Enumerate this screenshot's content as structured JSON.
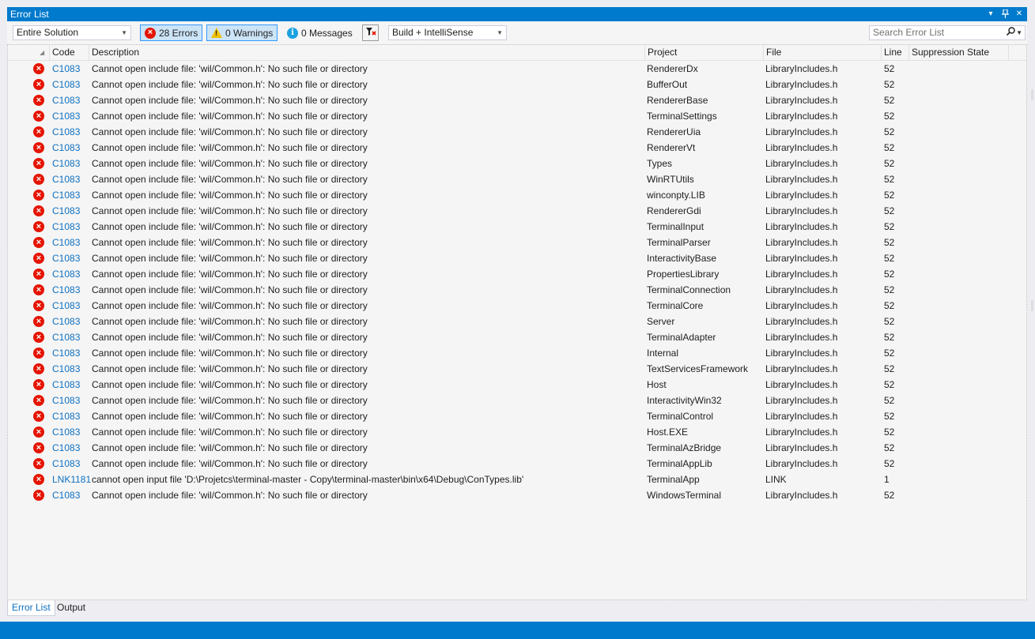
{
  "panel": {
    "title": "Error List",
    "menu_glyph": "▾",
    "pin_glyph": "📌",
    "close_glyph": "✕"
  },
  "toolbar": {
    "scope": "Entire Solution",
    "errors_label": "28 Errors",
    "warnings_label": "0 Warnings",
    "messages_label": "0 Messages",
    "source": "Build + IntelliSense",
    "search_placeholder": "Search Error List"
  },
  "columns": {
    "code": "Code",
    "description": "Description",
    "project": "Project",
    "file": "File",
    "line": "Line",
    "suppression": "Suppression State"
  },
  "rows": [
    {
      "code": "C1083",
      "description": "Cannot open include file: 'wil/Common.h': No such file or directory",
      "project": "RendererDx",
      "file": "LibraryIncludes.h",
      "line": "52"
    },
    {
      "code": "C1083",
      "description": "Cannot open include file: 'wil/Common.h': No such file or directory",
      "project": "BufferOut",
      "file": "LibraryIncludes.h",
      "line": "52"
    },
    {
      "code": "C1083",
      "description": "Cannot open include file: 'wil/Common.h': No such file or directory",
      "project": "RendererBase",
      "file": "LibraryIncludes.h",
      "line": "52"
    },
    {
      "code": "C1083",
      "description": "Cannot open include file: 'wil/Common.h': No such file or directory",
      "project": "TerminalSettings",
      "file": "LibraryIncludes.h",
      "line": "52"
    },
    {
      "code": "C1083",
      "description": "Cannot open include file: 'wil/Common.h': No such file or directory",
      "project": "RendererUia",
      "file": "LibraryIncludes.h",
      "line": "52"
    },
    {
      "code": "C1083",
      "description": "Cannot open include file: 'wil/Common.h': No such file or directory",
      "project": "RendererVt",
      "file": "LibraryIncludes.h",
      "line": "52"
    },
    {
      "code": "C1083",
      "description": "Cannot open include file: 'wil/Common.h': No such file or directory",
      "project": "Types",
      "file": "LibraryIncludes.h",
      "line": "52"
    },
    {
      "code": "C1083",
      "description": "Cannot open include file: 'wil/Common.h': No such file or directory",
      "project": "WinRTUtils",
      "file": "LibraryIncludes.h",
      "line": "52"
    },
    {
      "code": "C1083",
      "description": "Cannot open include file: 'wil/Common.h': No such file or directory",
      "project": "winconpty.LIB",
      "file": "LibraryIncludes.h",
      "line": "52"
    },
    {
      "code": "C1083",
      "description": "Cannot open include file: 'wil/Common.h': No such file or directory",
      "project": "RendererGdi",
      "file": "LibraryIncludes.h",
      "line": "52"
    },
    {
      "code": "C1083",
      "description": "Cannot open include file: 'wil/Common.h': No such file or directory",
      "project": "TerminalInput",
      "file": "LibraryIncludes.h",
      "line": "52"
    },
    {
      "code": "C1083",
      "description": "Cannot open include file: 'wil/Common.h': No such file or directory",
      "project": "TerminalParser",
      "file": "LibraryIncludes.h",
      "line": "52"
    },
    {
      "code": "C1083",
      "description": "Cannot open include file: 'wil/Common.h': No such file or directory",
      "project": "InteractivityBase",
      "file": "LibraryIncludes.h",
      "line": "52"
    },
    {
      "code": "C1083",
      "description": "Cannot open include file: 'wil/Common.h': No such file or directory",
      "project": "PropertiesLibrary",
      "file": "LibraryIncludes.h",
      "line": "52"
    },
    {
      "code": "C1083",
      "description": "Cannot open include file: 'wil/Common.h': No such file or directory",
      "project": "TerminalConnection",
      "file": "LibraryIncludes.h",
      "line": "52"
    },
    {
      "code": "C1083",
      "description": "Cannot open include file: 'wil/Common.h': No such file or directory",
      "project": "TerminalCore",
      "file": "LibraryIncludes.h",
      "line": "52"
    },
    {
      "code": "C1083",
      "description": "Cannot open include file: 'wil/Common.h': No such file or directory",
      "project": "Server",
      "file": "LibraryIncludes.h",
      "line": "52"
    },
    {
      "code": "C1083",
      "description": "Cannot open include file: 'wil/Common.h': No such file or directory",
      "project": "TerminalAdapter",
      "file": "LibraryIncludes.h",
      "line": "52"
    },
    {
      "code": "C1083",
      "description": "Cannot open include file: 'wil/Common.h': No such file or directory",
      "project": "Internal",
      "file": "LibraryIncludes.h",
      "line": "52"
    },
    {
      "code": "C1083",
      "description": "Cannot open include file: 'wil/Common.h': No such file or directory",
      "project": "TextServicesFramework",
      "file": "LibraryIncludes.h",
      "line": "52"
    },
    {
      "code": "C1083",
      "description": "Cannot open include file: 'wil/Common.h': No such file or directory",
      "project": "Host",
      "file": "LibraryIncludes.h",
      "line": "52"
    },
    {
      "code": "C1083",
      "description": "Cannot open include file: 'wil/Common.h': No such file or directory",
      "project": "InteractivityWin32",
      "file": "LibraryIncludes.h",
      "line": "52"
    },
    {
      "code": "C1083",
      "description": "Cannot open include file: 'wil/Common.h': No such file or directory",
      "project": "TerminalControl",
      "file": "LibraryIncludes.h",
      "line": "52"
    },
    {
      "code": "C1083",
      "description": "Cannot open include file: 'wil/Common.h': No such file or directory",
      "project": "Host.EXE",
      "file": "LibraryIncludes.h",
      "line": "52"
    },
    {
      "code": "C1083",
      "description": "Cannot open include file: 'wil/Common.h': No such file or directory",
      "project": "TerminalAzBridge",
      "file": "LibraryIncludes.h",
      "line": "52"
    },
    {
      "code": "C1083",
      "description": "Cannot open include file: 'wil/Common.h': No such file or directory",
      "project": "TerminalAppLib",
      "file": "LibraryIncludes.h",
      "line": "52"
    },
    {
      "code": "LNK1181",
      "description": "cannot open input file 'D:\\Projetcs\\terminal-master - Copy\\terminal-master\\bin\\x64\\Debug\\ConTypes.lib'",
      "project": "TerminalApp",
      "file": "LINK",
      "line": "1"
    },
    {
      "code": "C1083",
      "description": "Cannot open include file: 'wil/Common.h': No such file or directory",
      "project": "WindowsTerminal",
      "file": "LibraryIncludes.h",
      "line": "52"
    }
  ],
  "tabs": [
    "Error List",
    "Output"
  ],
  "icons": {
    "error": "error-circle-icon",
    "warning": "warning-triangle-icon",
    "info": "info-circle-icon",
    "filter": "filter-icon",
    "search": "search-icon"
  },
  "colors": {
    "accent": "#007acc",
    "error": "#e51400",
    "warning": "#f0c000",
    "info": "#1ba1e2",
    "link": "#0e70c0"
  }
}
